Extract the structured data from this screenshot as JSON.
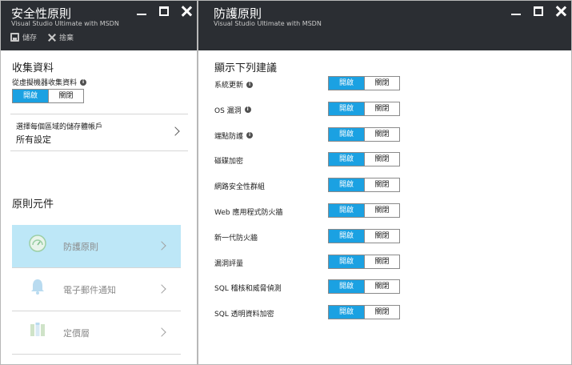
{
  "left_blade": {
    "title": "安全性原則",
    "subtitle": "Visual Studio Ultimate with MSDN",
    "commands": {
      "save": "儲存",
      "discard": "捨棄"
    },
    "collect_section": {
      "title": "收集資料",
      "field_label": "從虛擬機器收集資料",
      "toggle": {
        "on": "開啟",
        "off": "關閉",
        "selected": "on"
      }
    },
    "storage": {
      "label": "選擇每個區域的儲存體帳戶",
      "value": "所有設定"
    },
    "components_title": "原則元件",
    "components": [
      {
        "label": "防護原則",
        "icon": "gauge-icon",
        "selected": true
      },
      {
        "label": "電子郵件通知",
        "icon": "bell-icon",
        "selected": false
      },
      {
        "label": "定價層",
        "icon": "pricing-table-icon",
        "selected": false
      }
    ]
  },
  "right_blade": {
    "title": "防護原則",
    "subtitle": "Visual Studio Ultimate with MSDN",
    "section_title": "顯示下列建議",
    "toggle_on": "開啟",
    "toggle_off": "關閉",
    "recommendations": [
      {
        "label": "系統更新",
        "info": true,
        "state": "on"
      },
      {
        "label": "OS 漏洞",
        "info": true,
        "state": "on"
      },
      {
        "label": "端點防護",
        "info": true,
        "state": "on"
      },
      {
        "label": "磁碟加密",
        "info": false,
        "state": "on"
      },
      {
        "label": "網路安全性群組",
        "info": false,
        "state": "on"
      },
      {
        "label": "Web 應用程式防火牆",
        "info": false,
        "state": "on"
      },
      {
        "label": "新一代防火牆",
        "info": false,
        "state": "on"
      },
      {
        "label": "漏洞評量",
        "info": false,
        "state": "on"
      },
      {
        "label": "SQL 稽核和威脅偵測",
        "info": false,
        "state": "on"
      },
      {
        "label": "SQL 透明資料加密",
        "info": false,
        "state": "on"
      }
    ]
  },
  "colors": {
    "header_bg": "#2b2e33",
    "toggle_on": "#1ba1e2",
    "selected_item": "#bde7f7"
  }
}
